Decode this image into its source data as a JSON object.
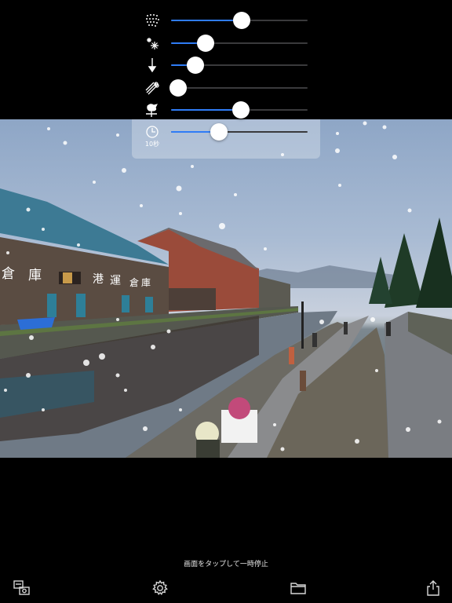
{
  "controls": [
    {
      "icon": "particles-icon",
      "level": 0.52
    },
    {
      "icon": "snowflake-size-icon",
      "level": 0.25
    },
    {
      "icon": "fall-speed-icon",
      "level": 0.18
    },
    {
      "icon": "wind-icon",
      "level": 0.05
    },
    {
      "icon": "weathervane-icon",
      "level": 0.51
    },
    {
      "icon": "timer-icon",
      "level": 0.35
    }
  ],
  "timer": {
    "label": "10秒"
  },
  "photo": {
    "signs": {
      "left_1": "倉",
      "left_2": "庫",
      "right_1": "港",
      "right_2": "運",
      "right_3": "倉",
      "right_4": "庫"
    }
  },
  "footer": {
    "hint": "画面をタップして一時停止"
  },
  "toolbar": [
    {
      "name": "camera-switch-icon"
    },
    {
      "name": "settings-gear-icon"
    },
    {
      "name": "folder-icon"
    },
    {
      "name": "share-icon"
    }
  ],
  "colors": {
    "accent": "#2f7cf6",
    "background": "#000000"
  }
}
